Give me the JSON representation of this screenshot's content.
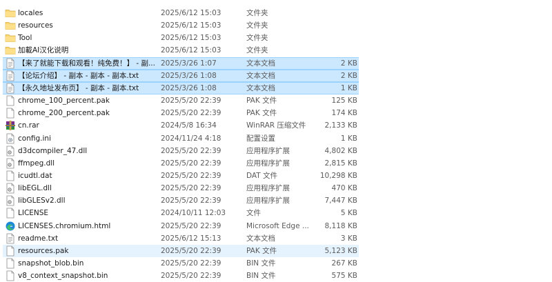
{
  "files": [
    {
      "name": "locales",
      "date": "2025/6/12 15:03",
      "type": "文件夹",
      "size": "",
      "icon": "folder-icon",
      "state": ""
    },
    {
      "name": "resources",
      "date": "2025/6/12 15:03",
      "type": "文件夹",
      "size": "",
      "icon": "folder-icon",
      "state": ""
    },
    {
      "name": "Tool",
      "date": "2025/6/12 15:03",
      "type": "文件夹",
      "size": "",
      "icon": "folder-icon",
      "state": ""
    },
    {
      "name": "加載AI汉化说明",
      "date": "2025/6/12 15:03",
      "type": "文件夹",
      "size": "",
      "icon": "folder-icon",
      "state": ""
    },
    {
      "name": "【来了就能下载和观看！纯免费！】 - 副...",
      "date": "2025/3/26 1:07",
      "type": "文本文档",
      "size": "2 KB",
      "icon": "text-file-icon",
      "state": "sel"
    },
    {
      "name": "【论坛介绍】 - 副本 - 副本 - 副本.txt",
      "date": "2025/3/26 1:08",
      "type": "文本文档",
      "size": "2 KB",
      "icon": "text-file-icon",
      "state": "sel"
    },
    {
      "name": "【永久地址发布页】 - 副本 - 副本.txt",
      "date": "2025/3/26 1:08",
      "type": "文本文档",
      "size": "1 KB",
      "icon": "text-file-icon",
      "state": "sel"
    },
    {
      "name": "chrome_100_percent.pak",
      "date": "2025/5/20 22:39",
      "type": "PAK 文件",
      "size": "125 KB",
      "icon": "file-icon",
      "state": ""
    },
    {
      "name": "chrome_200_percent.pak",
      "date": "2025/5/20 22:39",
      "type": "PAK 文件",
      "size": "174 KB",
      "icon": "file-icon",
      "state": ""
    },
    {
      "name": "cn.rar",
      "date": "2024/5/8 16:34",
      "type": "WinRAR 压缩文件",
      "size": "2,133 KB",
      "icon": "winrar-icon",
      "state": ""
    },
    {
      "name": "config.ini",
      "date": "2024/11/24 4:18",
      "type": "配置设置",
      "size": "1 KB",
      "icon": "settings-file-icon",
      "state": ""
    },
    {
      "name": "d3dcompiler_47.dll",
      "date": "2025/5/20 22:39",
      "type": "应用程序扩展",
      "size": "4,802 KB",
      "icon": "dll-icon",
      "state": ""
    },
    {
      "name": "ffmpeg.dll",
      "date": "2025/5/20 22:39",
      "type": "应用程序扩展",
      "size": "2,815 KB",
      "icon": "dll-icon",
      "state": ""
    },
    {
      "name": "icudtl.dat",
      "date": "2025/5/20 22:39",
      "type": "DAT 文件",
      "size": "10,298 KB",
      "icon": "file-icon",
      "state": ""
    },
    {
      "name": "libEGL.dll",
      "date": "2025/5/20 22:39",
      "type": "应用程序扩展",
      "size": "470 KB",
      "icon": "dll-icon",
      "state": ""
    },
    {
      "name": "libGLESv2.dll",
      "date": "2025/5/20 22:39",
      "type": "应用程序扩展",
      "size": "7,447 KB",
      "icon": "dll-icon",
      "state": ""
    },
    {
      "name": "LICENSE",
      "date": "2024/10/11 12:03",
      "type": "文件",
      "size": "5 KB",
      "icon": "file-icon",
      "state": ""
    },
    {
      "name": "LICENSES.chromium.html",
      "date": "2025/5/20 22:39",
      "type": "Microsoft Edge ...",
      "size": "8,118 KB",
      "icon": "edge-icon",
      "state": ""
    },
    {
      "name": "readme.txt",
      "date": "2025/6/12 15:13",
      "type": "文本文档",
      "size": "3 KB",
      "icon": "text-file-icon",
      "state": ""
    },
    {
      "name": "resources.pak",
      "date": "2025/5/20 22:39",
      "type": "PAK 文件",
      "size": "5,123 KB",
      "icon": "file-icon",
      "state": "hover"
    },
    {
      "name": "snapshot_blob.bin",
      "date": "2025/5/20 22:39",
      "type": "BIN 文件",
      "size": "267 KB",
      "icon": "file-icon",
      "state": ""
    },
    {
      "name": "v8_context_snapshot.bin",
      "date": "2025/5/20 22:39",
      "type": "BIN 文件",
      "size": "575 KB",
      "icon": "file-icon",
      "state": ""
    }
  ]
}
